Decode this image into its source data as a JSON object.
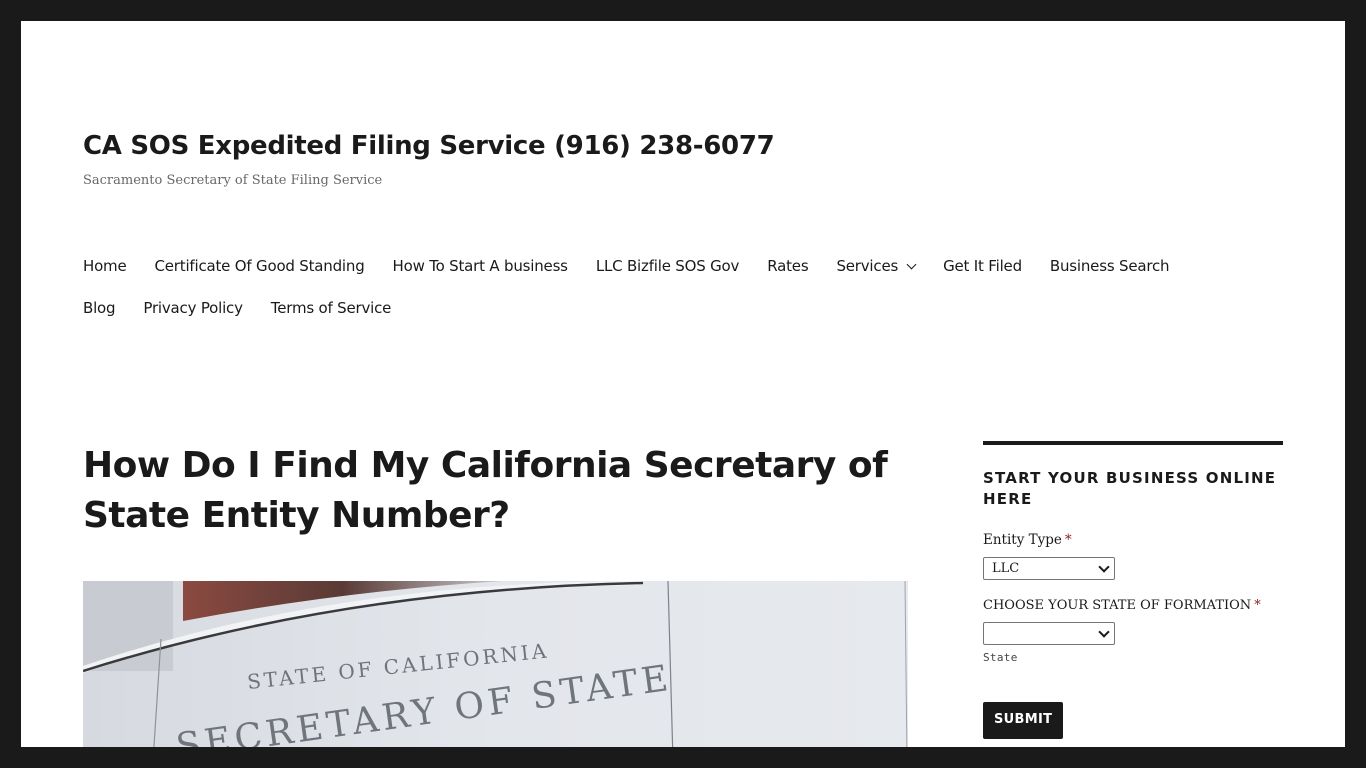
{
  "site": {
    "title": "CA SOS Expedited Filing Service (916) 238-6077",
    "description": "Sacramento Secretary of State Filing Service"
  },
  "nav": {
    "row1": [
      {
        "label": "Home"
      },
      {
        "label": "Certificate Of Good Standing"
      },
      {
        "label": "How To Start A business"
      },
      {
        "label": "LLC Bizfile SOS Gov"
      },
      {
        "label": "Rates"
      },
      {
        "label": "Services",
        "has_submenu": true,
        "icon": "chevron-down-icon"
      },
      {
        "label": "Get It Filed"
      },
      {
        "label": "Business Search"
      }
    ],
    "row2": [
      {
        "label": "Blog"
      },
      {
        "label": "Privacy Policy"
      },
      {
        "label": "Terms of Service"
      }
    ]
  },
  "article": {
    "title": "How Do I Find My California Secretary of State Entity Number?",
    "image": {
      "alt": "State of California Secretary of State building sign",
      "text_line1": "STATE OF CALIFORNIA",
      "text_line2": "SECRETARY OF STATE"
    }
  },
  "sidebar": {
    "widget_title": "START YOUR BUSINESS ONLINE HERE",
    "form": {
      "entity_type_label": "Entity Type",
      "entity_type_value": "LLC",
      "required_mark": "*",
      "state_label": "CHOOSE YOUR STATE OF FORMATION",
      "state_value": "",
      "state_sublabel": "State",
      "submit_label": "SUBMIT"
    }
  },
  "colors": {
    "frame": "#1a1a1a",
    "text": "#1a1a1a",
    "muted": "#686868",
    "required": "#8c2020"
  }
}
